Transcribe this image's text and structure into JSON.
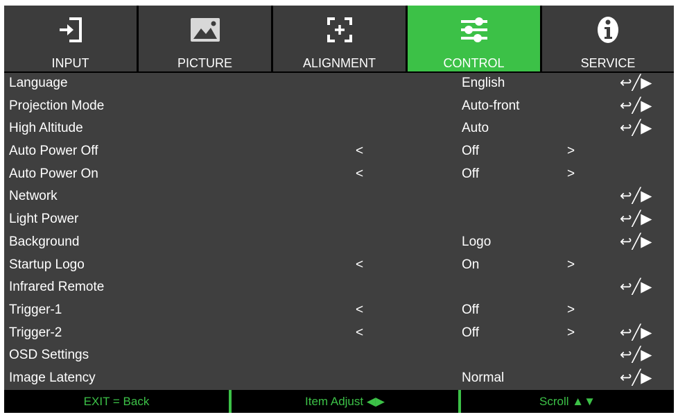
{
  "tabs": [
    {
      "label": "INPUT",
      "icon": "input-icon",
      "active": false
    },
    {
      "label": "PICTURE",
      "icon": "picture-icon",
      "active": false
    },
    {
      "label": "ALIGNMENT",
      "icon": "alignment-icon",
      "active": false
    },
    {
      "label": "CONTROL",
      "icon": "sliders-icon",
      "active": true
    },
    {
      "label": "SERVICE",
      "icon": "info-icon",
      "active": false
    }
  ],
  "colors": {
    "accent": "#3cc147",
    "tab_bg": "#3c3c3c",
    "row_bg": "#3f3f3f"
  },
  "rows": [
    {
      "name": "Language",
      "value": "English",
      "left_arrow": "",
      "right_arrow": "",
      "enter": "↩╱▶"
    },
    {
      "name": "Projection Mode",
      "value": "Auto-front",
      "left_arrow": "",
      "right_arrow": "",
      "enter": "↩╱▶"
    },
    {
      "name": "High Altitude",
      "value": "Auto",
      "left_arrow": "",
      "right_arrow": "",
      "enter": "↩╱▶"
    },
    {
      "name": "Auto Power Off",
      "value": "Off",
      "left_arrow": "<",
      "right_arrow": ">",
      "enter": ""
    },
    {
      "name": "Auto Power On",
      "value": "Off",
      "left_arrow": "<",
      "right_arrow": ">",
      "enter": ""
    },
    {
      "name": "Network",
      "value": "",
      "left_arrow": "",
      "right_arrow": "",
      "enter": "↩╱▶"
    },
    {
      "name": "Light Power",
      "value": "",
      "left_arrow": "",
      "right_arrow": "",
      "enter": "↩╱▶"
    },
    {
      "name": "Background",
      "value": "Logo",
      "left_arrow": "",
      "right_arrow": "",
      "enter": "↩╱▶"
    },
    {
      "name": "Startup Logo",
      "value": "On",
      "left_arrow": "<",
      "right_arrow": ">",
      "enter": ""
    },
    {
      "name": "Infrared Remote",
      "value": "",
      "left_arrow": "",
      "right_arrow": "",
      "enter": "↩╱▶"
    },
    {
      "name": "Trigger-1",
      "value": "Off",
      "left_arrow": "<",
      "right_arrow": ">",
      "enter": ""
    },
    {
      "name": "Trigger-2",
      "value": "Off",
      "left_arrow": "<",
      "right_arrow": ">",
      "enter": "↩╱▶"
    },
    {
      "name": "OSD Settings",
      "value": "",
      "left_arrow": "",
      "right_arrow": "",
      "enter": "↩╱▶"
    },
    {
      "name": "Image Latency",
      "value": "Normal",
      "left_arrow": "",
      "right_arrow": "",
      "enter": "↩╱▶"
    }
  ],
  "footer": {
    "exit": "EXIT = Back",
    "adjust": "Item Adjust ◀▶",
    "scroll": "Scroll ▲▼"
  }
}
